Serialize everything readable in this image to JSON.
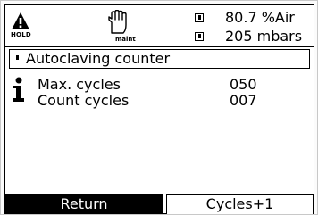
{
  "status_bar": {
    "hold_label": "HOLD",
    "maint_label": "maint",
    "readings": [
      {
        "value": "80.7 %Air"
      },
      {
        "value": "205 mbars"
      }
    ]
  },
  "menu": {
    "title": "Autoclaving counter"
  },
  "info": {
    "rows": [
      {
        "label": "Max. cycles",
        "value": "050"
      },
      {
        "label": "Count cycles",
        "value": "007"
      }
    ]
  },
  "softkeys": {
    "left": "Return",
    "right": "Cycles+1"
  },
  "icons": {
    "warning": "warning-triangle-icon",
    "maintenance": "hand-icon",
    "channel": "channel-square-icon",
    "info": "info-icon"
  }
}
